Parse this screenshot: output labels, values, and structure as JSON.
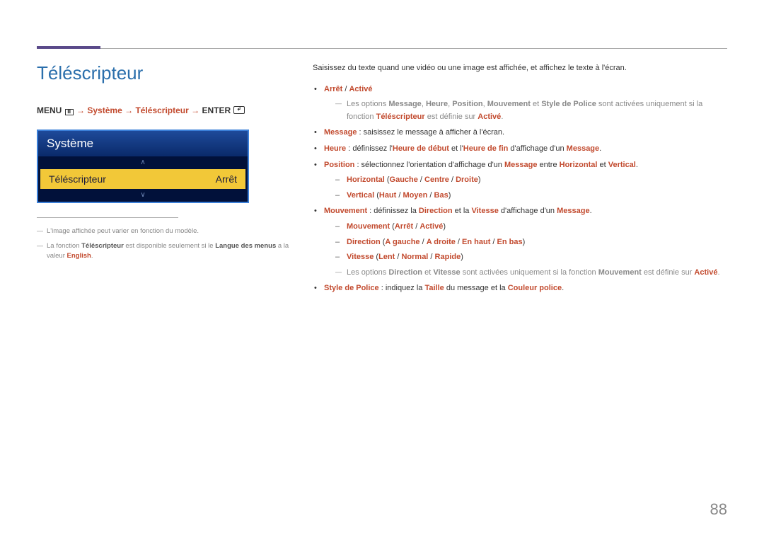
{
  "pageNumber": "88",
  "sectionTitle": "Téléscripteur",
  "nav": {
    "menu": "MENU",
    "arrow": "→",
    "p1": "Système",
    "p2": "Téléscripteur",
    "enter": "ENTER"
  },
  "osd": {
    "title": "Système",
    "item": "Téléscripteur",
    "value": "Arrêt"
  },
  "footnotes": {
    "f1": "L'image affichée peut varier en fonction du modèle.",
    "f2_a": "La fonction ",
    "f2_b": "Téléscripteur",
    "f2_c": " est disponible seulement si le ",
    "f2_d": "Langue des menus",
    "f2_e": " a la valeur ",
    "f2_f": "English",
    "f2_g": "."
  },
  "intro": "Saisissez du texte quand une vidéo ou une image est affichée, et affichez le texte à l'écran.",
  "b1": {
    "off": "Arrêt",
    "sep": " / ",
    "on": "Activé"
  },
  "note1": {
    "a": "Les options ",
    "msg": "Message",
    "c1": ", ",
    "heure": "Heure",
    "c2": ", ",
    "pos": "Position",
    "c3": ", ",
    "mouv": "Mouvement",
    "et": " et ",
    "style": "Style de Police",
    "b": " sont activées uniquement si la fonction ",
    "tele": "Téléscripteur",
    "c": " est définie sur ",
    "active": "Activé",
    "d": "."
  },
  "b2": {
    "k": "Message",
    "t": " : saisissez le message à afficher à l'écran."
  },
  "b3": {
    "k": "Heure",
    "a": " : définissez l'",
    "hd": "Heure de début",
    "et": " et l'",
    "hf": "Heure de fin",
    "b": " d'affichage d'un ",
    "msg": "Message",
    "p": "."
  },
  "b4": {
    "k": "Position",
    "a": " : sélectionnez l'orientation d'affichage d'un ",
    "msg": "Message",
    "b": " entre ",
    "hor": "Horizontal",
    "et": " et ",
    "ver": "Vertical",
    "p": "."
  },
  "s4a": {
    "hor": "Horizontal",
    "op": " (",
    "g": "Gauche",
    "s": " / ",
    "c": "Centre",
    "d": "Droite",
    "cp": ")"
  },
  "s4b": {
    "ver": "Vertical",
    "op": " (",
    "h": "Haut",
    "s": " / ",
    "m": "Moyen",
    "b": "Bas",
    "cp": ")"
  },
  "b5": {
    "k": "Mouvement",
    "a": " : définissez la ",
    "dir": "Direction",
    "b": " et la ",
    "vit": "Vitesse",
    "c": " d'affichage d'un ",
    "msg": "Message",
    "p": "."
  },
  "s5a": {
    "mouv": "Mouvement",
    "op": " (",
    "off": "Arrêt",
    "s": " / ",
    "on": "Activé",
    "cp": ")"
  },
  "s5b": {
    "dir": "Direction",
    "op": " (",
    "ag": "A gauche",
    "s": " / ",
    "ad": "A droite",
    "eh": "En haut",
    "eb": "En bas",
    "cp": ")"
  },
  "s5c": {
    "vit": "Vitesse",
    "op": " (",
    "l": "Lent",
    "s": " / ",
    "n": "Normal",
    "r": "Rapide",
    "cp": ")"
  },
  "note5": {
    "a": "Les options ",
    "dir": "Direction",
    "et": " et ",
    "vit": "Vitesse",
    "b": " sont activées uniquement si la fonction ",
    "mouv": "Mouvement",
    "c": " est définie sur ",
    "on": "Activé",
    "p": "."
  },
  "b6": {
    "k": "Style de Police",
    "a": " : indiquez la ",
    "t": "Taille",
    "b": " du message et la ",
    "cp": "Couleur police",
    "p": "."
  }
}
